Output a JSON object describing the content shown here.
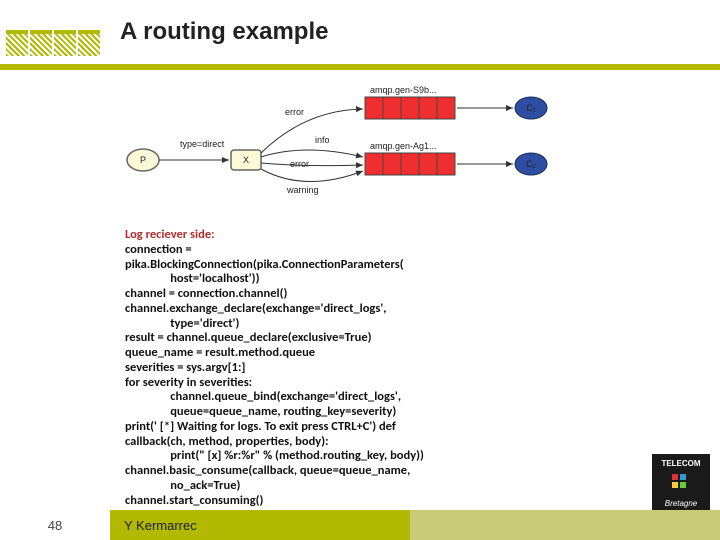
{
  "slide": {
    "title": "A routing example",
    "page_number": "48",
    "author": "Y Kermarrec"
  },
  "diagram": {
    "producer": "P",
    "exchange": "X",
    "consumer1": "C₁",
    "consumer2": "C₂",
    "label_type": "type=direct",
    "label_error_top": "error",
    "label_info": "info",
    "label_error_mid": "error",
    "label_warning": "warning",
    "queue1_label": "amqp.gen-S9b...",
    "queue2_label": "amqp.gen-Ag1..."
  },
  "code": {
    "heading": "Log reciever side:",
    "lines": [
      "connection =",
      "pika.BlockingConnection(pika.ConnectionParameters(",
      "                host='localhost'))",
      "channel = connection.channel()",
      "channel.exchange_declare(exchange='direct_logs',",
      "                type='direct')",
      "result = channel.queue_declare(exclusive=True)",
      "queue_name = result.method.queue",
      "severities = sys.argv[1:]",
      "for severity in severities:",
      "                channel.queue_bind(exchange='direct_logs',",
      "                queue=queue_name, routing_key=severity)",
      "print(' [*] Waiting for logs. To exit press CTRL+C') def",
      "callback(ch, method, properties, body):",
      "                print(\" [x] %r:%r\" % (method.routing_key, body))",
      "channel.basic_consume(callback, queue=queue_name,",
      "                no_ack=True)",
      "channel.start_consuming()"
    ]
  },
  "logo": {
    "line1": "TELECOM",
    "line2": "Bretagne"
  }
}
